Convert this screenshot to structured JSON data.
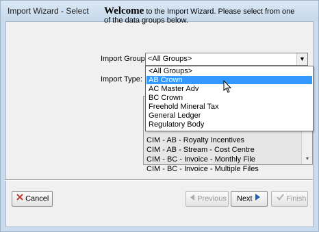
{
  "window": {
    "title": "Import Wizard - Select"
  },
  "welcome": {
    "big": "Welcome",
    "rest": " to the Import Wizard.  Please select from one of the data groups below."
  },
  "form": {
    "import_group_label": "Import Group:",
    "import_group_value": "<All Groups>",
    "import_type_label": "Import Type:"
  },
  "group_options": [
    "<All Groups>",
    "AB Crown",
    "AC Master Adv",
    "BC Crown",
    "Freehold Mineral Tax",
    "General Ledger",
    "Regulatory Body"
  ],
  "selected_option": "AB Crown",
  "type_list": [
    "CIM - AB - Royalty Incentives",
    "CIM - AB - Stream - Cost Centre",
    "CIM - BC - Invoice - Monthly File",
    "CIM - BC - Invoice - Multiple Files"
  ],
  "buttons": {
    "cancel": "Cancel",
    "previous": "Previous",
    "next": "Next",
    "finish": "Finish"
  },
  "colors": {
    "selection": "#3399ff",
    "cancel_icon": "#c0392b",
    "next_arrow": "#1f5fbf",
    "finish_check": "#b0b0b0"
  },
  "icons": {
    "cancel": "red-x-icon",
    "previous": "left-arrow-icon",
    "next": "right-arrow-icon",
    "finish": "checkmark-icon",
    "dropdown": "chevron-down-icon",
    "cursor": "mouse-pointer-icon"
  }
}
